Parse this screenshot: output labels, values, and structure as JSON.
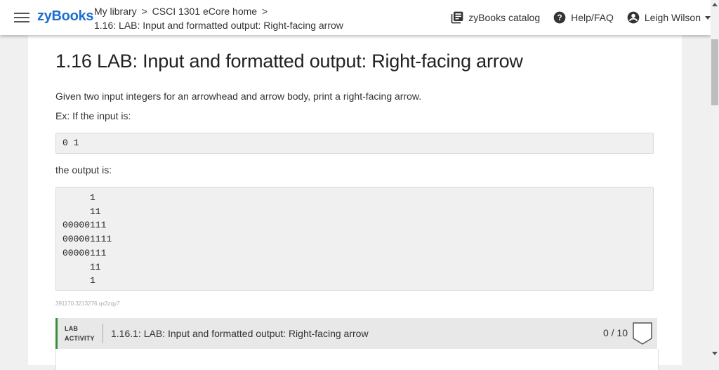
{
  "header": {
    "logo": "zyBooks",
    "breadcrumb": {
      "my_library": "My library",
      "separator": ">",
      "course": "CSCI 1301 eCore home",
      "current": "1.16: LAB: Input and formatted output: Right-facing arrow"
    },
    "catalog_label": "zyBooks catalog",
    "help_label": "Help/FAQ",
    "user_name": "Leigh Wilson"
  },
  "main": {
    "title": "1.16 LAB: Input and formatted output: Right-facing arrow",
    "intro": "Given two input integers for an arrowhead and arrow body, print a right-facing arrow.",
    "example_label": "Ex: If the input is:",
    "example_input": "0 1",
    "output_label": "the output is:",
    "example_output": "     1\n     11\n00000111\n000001111\n00000111\n     11\n     1",
    "content_id": "391170.3213276.qx3zqy7"
  },
  "lab_activity": {
    "tag_line1": "LAB",
    "tag_line2": "ACTIVITY",
    "title": "1.16.1: LAB: Input and formatted output: Right-facing arrow",
    "score": "0 / 10"
  },
  "colors": {
    "logo": "#1e6fd0",
    "lab_accent": "#3b8d3b"
  }
}
